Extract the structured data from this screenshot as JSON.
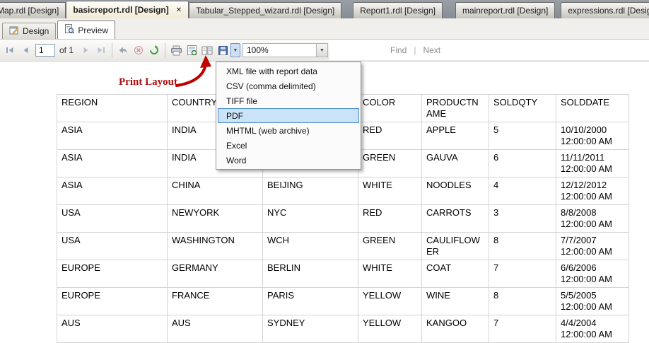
{
  "document_tabs": [
    {
      "label": "Map.rdl [Design]",
      "active": false
    },
    {
      "label": "basicreport.rdl [Design]",
      "active": true
    },
    {
      "label": "Tabular_Stepped_wizard.rdl [Design]",
      "active": false
    },
    {
      "label": "Report1.rdl [Design]",
      "active": false
    },
    {
      "label": "mainreport.rdl [Design]",
      "active": false
    },
    {
      "label": "expressions.rdl [Design]",
      "active": false
    }
  ],
  "view_tabs": [
    {
      "label": "Design",
      "active": false
    },
    {
      "label": "Preview",
      "active": true
    }
  ],
  "toolbar": {
    "page_number": "1",
    "page_count_label": "of 1",
    "zoom_value": "100%",
    "find_label": "Find",
    "find_separator": "|",
    "find_next_label": "Next"
  },
  "annotation": {
    "label": "Print Layout"
  },
  "export_menu": {
    "items": [
      {
        "label": "XML file with report data",
        "highlighted": false
      },
      {
        "label": "CSV (comma delimited)",
        "highlighted": false
      },
      {
        "label": "TIFF file",
        "highlighted": false
      },
      {
        "label": "PDF",
        "highlighted": true
      },
      {
        "label": "MHTML (web archive)",
        "highlighted": false
      },
      {
        "label": "Excel",
        "highlighted": false
      },
      {
        "label": "Word",
        "highlighted": false
      }
    ]
  },
  "report_table": {
    "columns": [
      "REGION",
      "COUNTRY",
      "",
      "COLOR",
      "PRODUCTNAME",
      "SOLDQTY",
      "SOLDDATE"
    ],
    "rows": [
      [
        "ASIA",
        "INDIA",
        "",
        "RED",
        "APPLE",
        "5",
        "10/10/2000 12:00:00 AM"
      ],
      [
        "ASIA",
        "INDIA",
        "",
        "GREEN",
        "GAUVA",
        "6",
        "11/11/2011 12:00:00 AM"
      ],
      [
        "ASIA",
        "CHINA",
        "BEIJING",
        "WHITE",
        "NOODLES",
        "4",
        "12/12/2012 12:00:00 AM"
      ],
      [
        "USA",
        "NEWYORK",
        "NYC",
        "RED",
        "CARROTS",
        "3",
        "8/8/2008 12:00:00 AM"
      ],
      [
        "USA",
        "WASHINGTON",
        "WCH",
        "GREEN",
        "CAULIFLOWER",
        "8",
        "7/7/2007 12:00:00 AM"
      ],
      [
        "EUROPE",
        "GERMANY",
        "BERLIN",
        "WHITE",
        "COAT",
        "7",
        "6/6/2006 12:00:00 AM"
      ],
      [
        "EUROPE",
        "FRANCE",
        "PARIS",
        "YELLOW",
        "WINE",
        "8",
        "5/5/2005 12:00:00 AM"
      ],
      [
        "AUS",
        "AUS",
        "SYDNEY",
        "YELLOW",
        "KANGOO",
        "7",
        "4/4/2004 12:00:00 AM"
      ]
    ]
  },
  "icons": {
    "tab_close": "✕",
    "dropdown_arrow": "▼"
  },
  "colors": {
    "annotation_red": "#b01010",
    "menu_highlight_bg": "#cbe3f8",
    "menu_highlight_border": "#4a8ccc",
    "active_tab_bg": "#f1ead3"
  }
}
